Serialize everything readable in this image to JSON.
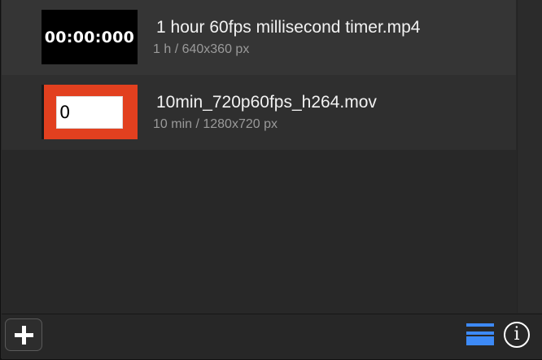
{
  "media_list": {
    "items": [
      {
        "thumbnail_text": "00:00:000",
        "title": "1 hour 60fps millisecond timer.mp4",
        "subtitle": "1 h / 640x360 px"
      },
      {
        "thumbnail_text": "0",
        "title": "10min_720p60fps_h264.mov",
        "subtitle": "10 min / 1280x720 px"
      }
    ]
  },
  "toolbar": {
    "add_icon": "plus-icon",
    "list_view_icon": "list-view-icon",
    "info_icon": "info-icon",
    "info_glyph": "i",
    "accent_color": "#3d8af7"
  },
  "colors": {
    "thumbnail_2_background": "#e2401f"
  }
}
